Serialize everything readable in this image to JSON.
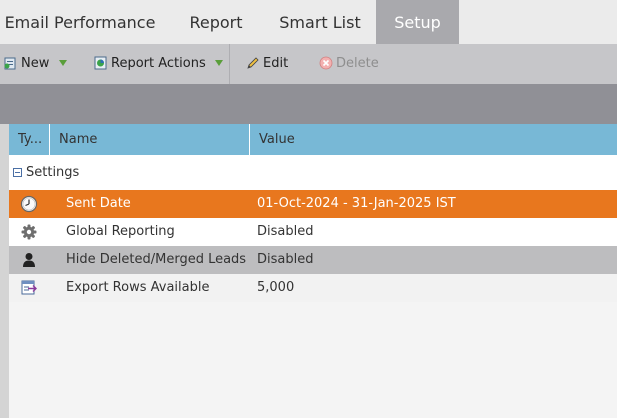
{
  "tabs": [
    {
      "label": "Email Performance",
      "active": false
    },
    {
      "label": "Report",
      "active": false
    },
    {
      "label": "Smart List",
      "active": false
    },
    {
      "label": "Setup",
      "active": true
    }
  ],
  "toolbar": {
    "new_label": "New",
    "report_actions_label": "Report Actions",
    "edit_label": "Edit",
    "delete_label": "Delete",
    "delete_disabled": true
  },
  "grid": {
    "columns": [
      "Ty...",
      "Name",
      "Value"
    ],
    "group_label": "Settings",
    "rows": [
      {
        "icon": "clock-icon",
        "name": "Sent Date",
        "value": "01-Oct-2024 - 31-Jan-2025 IST",
        "selected": true
      },
      {
        "icon": "gear-icon",
        "name": "Global Reporting",
        "value": "Disabled",
        "selected": false
      },
      {
        "icon": "person-icon",
        "name": "Hide Deleted/Merged Leads",
        "value": "Disabled",
        "selected": false
      },
      {
        "icon": "export-rows-icon",
        "name": "Export Rows Available",
        "value": "5,000",
        "selected": false
      }
    ]
  },
  "colors": {
    "selected_row": "#e8771e",
    "header": "#78b8d6",
    "active_tab": "#a9a9ad"
  }
}
